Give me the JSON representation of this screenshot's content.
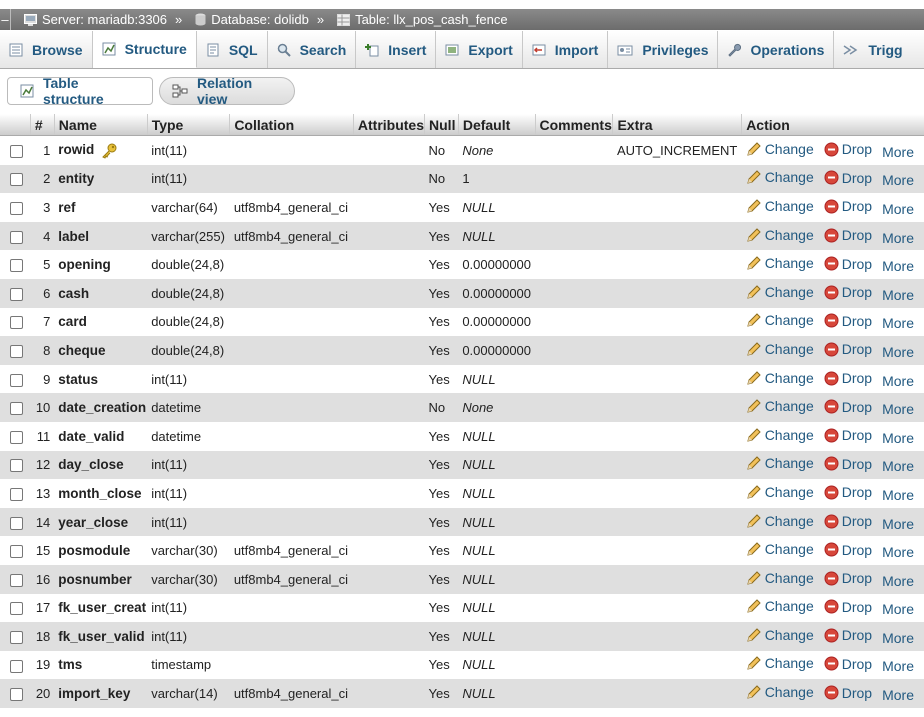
{
  "breadcrumb": {
    "dash": "–",
    "server": "Server: mariadb:3306",
    "database": "Database: dolidb",
    "table": "Table: llx_pos_cash_fence",
    "sep": "»"
  },
  "tabs": [
    {
      "label": "Browse",
      "icon": "browse-icon"
    },
    {
      "label": "Structure",
      "icon": "structure-icon"
    },
    {
      "label": "SQL",
      "icon": "sql-icon"
    },
    {
      "label": "Search",
      "icon": "search-icon"
    },
    {
      "label": "Insert",
      "icon": "insert-icon"
    },
    {
      "label": "Export",
      "icon": "export-icon"
    },
    {
      "label": "Import",
      "icon": "import-icon"
    },
    {
      "label": "Privileges",
      "icon": "privileges-icon"
    },
    {
      "label": "Operations",
      "icon": "wrench-icon"
    },
    {
      "label": "Trigg",
      "icon": "triggers-icon"
    }
  ],
  "subtabs": {
    "table_structure": "Table structure",
    "relation_view": "Relation view"
  },
  "columns": [
    "#",
    "Name",
    "Type",
    "Collation",
    "Attributes",
    "Null",
    "Default",
    "Comments",
    "Extra",
    "Action"
  ],
  "actions": {
    "change": "Change",
    "drop": "Drop",
    "more": "More"
  },
  "rows": [
    {
      "n": "1",
      "name": "rowid",
      "type": "int(11)",
      "collation": "",
      "null": "No",
      "default": "None",
      "italic": true,
      "extra": "AUTO_INCREMENT",
      "key": true
    },
    {
      "n": "2",
      "name": "entity",
      "type": "int(11)",
      "collation": "",
      "null": "No",
      "default": "1",
      "italic": false,
      "extra": ""
    },
    {
      "n": "3",
      "name": "ref",
      "type": "varchar(64)",
      "collation": "utf8mb4_general_ci",
      "null": "Yes",
      "default": "NULL",
      "italic": true,
      "extra": ""
    },
    {
      "n": "4",
      "name": "label",
      "type": "varchar(255)",
      "collation": "utf8mb4_general_ci",
      "null": "Yes",
      "default": "NULL",
      "italic": true,
      "extra": ""
    },
    {
      "n": "5",
      "name": "opening",
      "type": "double(24,8)",
      "collation": "",
      "null": "Yes",
      "default": "0.00000000",
      "italic": false,
      "extra": ""
    },
    {
      "n": "6",
      "name": "cash",
      "type": "double(24,8)",
      "collation": "",
      "null": "Yes",
      "default": "0.00000000",
      "italic": false,
      "extra": ""
    },
    {
      "n": "7",
      "name": "card",
      "type": "double(24,8)",
      "collation": "",
      "null": "Yes",
      "default": "0.00000000",
      "italic": false,
      "extra": ""
    },
    {
      "n": "8",
      "name": "cheque",
      "type": "double(24,8)",
      "collation": "",
      "null": "Yes",
      "default": "0.00000000",
      "italic": false,
      "extra": ""
    },
    {
      "n": "9",
      "name": "status",
      "type": "int(11)",
      "collation": "",
      "null": "Yes",
      "default": "NULL",
      "italic": true,
      "extra": ""
    },
    {
      "n": "10",
      "name": "date_creation",
      "type": "datetime",
      "collation": "",
      "null": "No",
      "default": "None",
      "italic": true,
      "extra": ""
    },
    {
      "n": "11",
      "name": "date_valid",
      "type": "datetime",
      "collation": "",
      "null": "Yes",
      "default": "NULL",
      "italic": true,
      "extra": ""
    },
    {
      "n": "12",
      "name": "day_close",
      "type": "int(11)",
      "collation": "",
      "null": "Yes",
      "default": "NULL",
      "italic": true,
      "extra": ""
    },
    {
      "n": "13",
      "name": "month_close",
      "type": "int(11)",
      "collation": "",
      "null": "Yes",
      "default": "NULL",
      "italic": true,
      "extra": ""
    },
    {
      "n": "14",
      "name": "year_close",
      "type": "int(11)",
      "collation": "",
      "null": "Yes",
      "default": "NULL",
      "italic": true,
      "extra": ""
    },
    {
      "n": "15",
      "name": "posmodule",
      "type": "varchar(30)",
      "collation": "utf8mb4_general_ci",
      "null": "Yes",
      "default": "NULL",
      "italic": true,
      "extra": ""
    },
    {
      "n": "16",
      "name": "posnumber",
      "type": "varchar(30)",
      "collation": "utf8mb4_general_ci",
      "null": "Yes",
      "default": "NULL",
      "italic": true,
      "extra": ""
    },
    {
      "n": "17",
      "name": "fk_user_creat",
      "type": "int(11)",
      "collation": "",
      "null": "Yes",
      "default": "NULL",
      "italic": true,
      "extra": ""
    },
    {
      "n": "18",
      "name": "fk_user_valid",
      "type": "int(11)",
      "collation": "",
      "null": "Yes",
      "default": "NULL",
      "italic": true,
      "extra": ""
    },
    {
      "n": "19",
      "name": "tms",
      "type": "timestamp",
      "collation": "",
      "null": "Yes",
      "default": "NULL",
      "italic": true,
      "extra": ""
    },
    {
      "n": "20",
      "name": "import_key",
      "type": "varchar(14)",
      "collation": "utf8mb4_general_ci",
      "null": "Yes",
      "default": "NULL",
      "italic": true,
      "extra": ""
    }
  ]
}
